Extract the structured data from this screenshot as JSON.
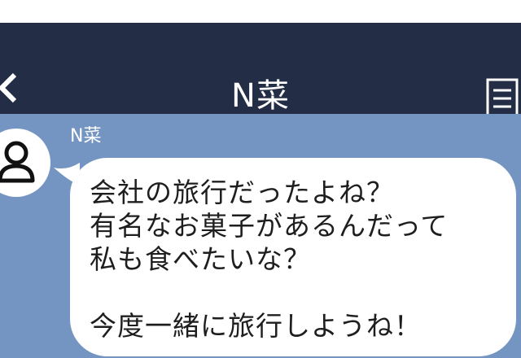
{
  "header": {
    "title": "N菜",
    "back_icon": "chevron-left-icon",
    "menu_icon": "menu-icon"
  },
  "message": {
    "sender": "N菜",
    "avatar_icon": "user-avatar-icon",
    "lines": [
      "会社の旅行だったよね？",
      "有名なお菓子があるんだって",
      "私も食べたいな？",
      "",
      "今度一緒に旅行しようね！"
    ]
  },
  "colors": {
    "header_bg": "#232d45",
    "chat_bg": "#7494c2",
    "bubble_bg": "#ffffff"
  }
}
